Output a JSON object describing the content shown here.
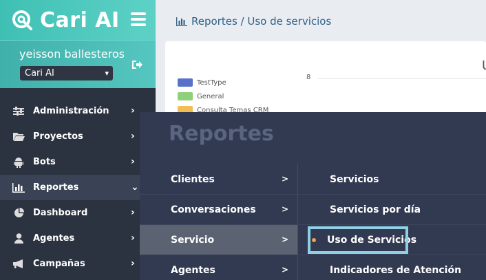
{
  "brand": {
    "name": "Cari AI"
  },
  "user": {
    "name": "yeisson ballesteros",
    "company": "Cari AI"
  },
  "nav": {
    "items": [
      {
        "label": "Administración",
        "icon": "sliders-icon"
      },
      {
        "label": "Proyectos",
        "icon": "folder-icon"
      },
      {
        "label": "Bots",
        "icon": "android-icon"
      },
      {
        "label": "Reportes",
        "icon": "bar-chart-icon",
        "active": true
      },
      {
        "label": "Dashboard",
        "icon": "pie-chart-icon"
      },
      {
        "label": "Agentes",
        "icon": "user-icon"
      },
      {
        "label": "Campañas",
        "icon": "megaphone-icon"
      }
    ]
  },
  "breadcrumb": "Reportes / Uso de servicios",
  "chart_data": {
    "type": "bar",
    "legend": [
      "TestType",
      "General",
      "Consulta Temas CRM"
    ],
    "colors": [
      "#5872c8",
      "#8fd07a",
      "#f2bd55"
    ],
    "y_tick_visible": "8",
    "title_partial": "U"
  },
  "mega_menu": {
    "title": "Reportes",
    "categories": [
      {
        "label": "Clientes"
      },
      {
        "label": "Conversaciones"
      },
      {
        "label": "Servicio",
        "selected": true
      },
      {
        "label": "Agentes"
      }
    ],
    "subitems": [
      {
        "label": "Servicios"
      },
      {
        "label": "Servicios por día"
      },
      {
        "label": "Uso de Servicios",
        "highlighted": true
      },
      {
        "label": "Indicadores de Atención"
      }
    ],
    "highlight_color": "#8fd0e6",
    "bullet_color": "#f0a04b"
  }
}
